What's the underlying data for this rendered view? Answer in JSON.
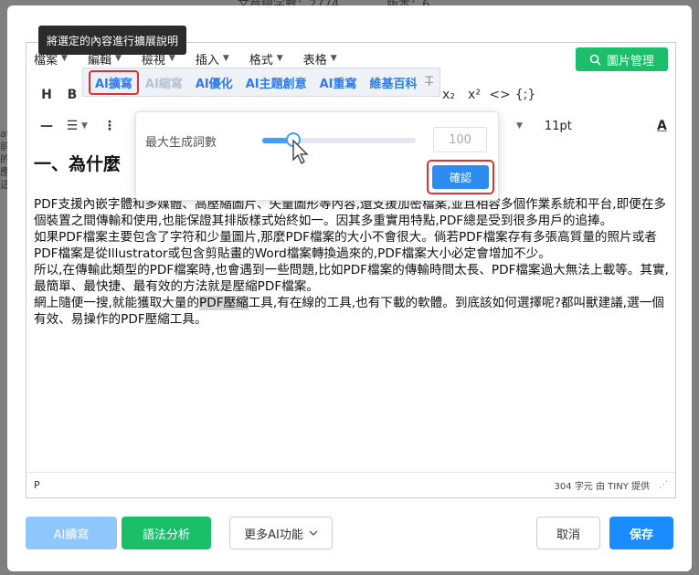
{
  "background": {
    "top_text": "文章總字數：2774　　　　版本：6",
    "side_text": [
      "at",
      "前",
      "的",
      "應",
      "這"
    ]
  },
  "tooltip": "將選定的內容進行擴展說明",
  "menubar": {
    "items": [
      {
        "label": "檔案"
      },
      {
        "label": "編輯"
      },
      {
        "label": "檢視"
      },
      {
        "label": "插入"
      },
      {
        "label": "格式"
      },
      {
        "label": "表格"
      }
    ],
    "image_manager": "圖片管理"
  },
  "ai_menu": {
    "options": [
      {
        "label": "AI擴寫",
        "state": "active"
      },
      {
        "label": "AI縮寫",
        "state": "disabled"
      },
      {
        "label": "AI優化",
        "state": "normal"
      },
      {
        "label": "AI主題創意",
        "state": "normal"
      },
      {
        "label": "AI重寫",
        "state": "normal"
      },
      {
        "label": "維基百科",
        "state": "normal"
      }
    ]
  },
  "toolbar": {
    "font_size": "11pt",
    "subscript": "x₂",
    "superscript": "x²",
    "code": "<>",
    "template": "{;}",
    "font_color": "A"
  },
  "popover": {
    "label": "最大生成詞數",
    "slider_fraction": 0.2,
    "input_value": "100",
    "confirm": "確認"
  },
  "content": {
    "heading": "一、為什麼",
    "paragraphs": [
      "PDF支援內嵌字體和多媒體、高壓縮圖片、矢量圖形等內容,還支援加密檔案,並且相容多個作業系統和平台,即便在多個裝置之間傳輸和使用,也能保證其排版樣式始終如一。因其多重實用特點,PDF總是受到很多用戶的追捧。",
      "如果PDF檔案主要包含了字符和少量圖片,那麼PDF檔案的大小不會很大。倘若PDF檔案存有多張高質量的照片或者PDF檔案是從Illustrator或包含剪貼畫的Word檔案轉換過來的,PDF檔案大小必定會增加不少。",
      "所以,在傳輸此類型的PDF檔案時,也會遇到一些問題,比如PDF檔案的傳輸時間太長、PDF檔案過大無法上載等。其實,最簡單、最快捷、最有效的方法就是壓縮PDF檔案。"
    ],
    "last_before": "網上隨便一搜,就能獲取大量的",
    "last_highlight": "PDF壓縮",
    "last_after": "工具,有在線的工具,也有下載的軟體。到底該如何選擇呢?都叫獸建議,選一個有效、易操作的PDF壓縮工具。"
  },
  "statusbar": {
    "path": "P",
    "count": "304 字元 由 TINY 提供"
  },
  "buttons": {
    "continue": "AI續寫",
    "grammar": "語法分析",
    "more": "更多AI功能",
    "cancel": "取消",
    "save": "保存"
  }
}
